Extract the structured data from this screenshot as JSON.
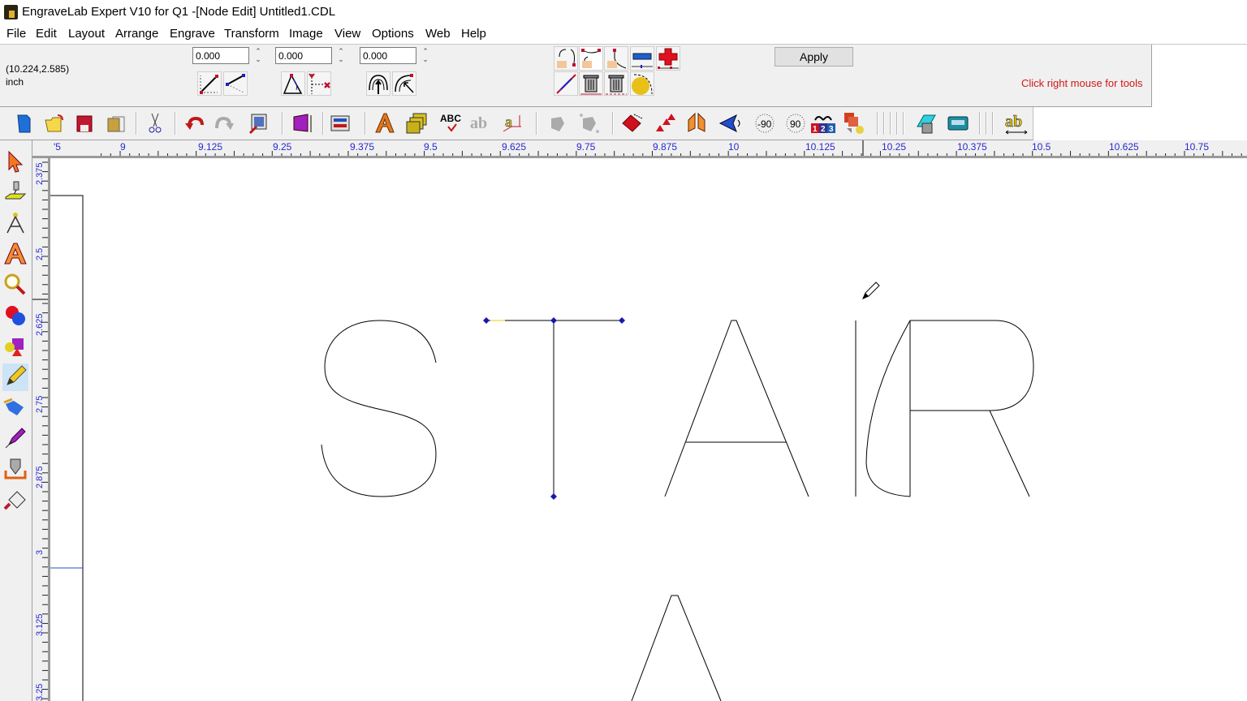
{
  "window": {
    "title": "EngraveLab Expert V10 for Q1 -[Node Edit] Untitled1.CDL",
    "app_icon": "engravelab-app-icon"
  },
  "menu": [
    "File",
    "Edit",
    "Layout",
    "Arrange",
    "Engrave",
    "Transform",
    "Image",
    "View",
    "Options",
    "Web",
    "Help"
  ],
  "property_bar": {
    "cursor_position": "(10.224,2.585)",
    "units": "inch",
    "fields": [
      {
        "value": "0.000",
        "icons": [
          "line-length-icon",
          "line-direction-icon"
        ]
      },
      {
        "value": "0.000",
        "icons": [
          "angle-icon",
          "delete-x-axis-icon"
        ]
      },
      {
        "value": "0.000",
        "icons": [
          "arc-up-icon",
          "arc-pointer-icon"
        ]
      }
    ],
    "node_tools": [
      "break-node-icon",
      "join-nodes-icon",
      "extend-node-icon",
      "delete-node-icon",
      "add-node-icon",
      "to-line-icon",
      "trash-node-icon",
      "trash-segment-icon",
      "to-curve-icon"
    ],
    "apply_label": "Apply",
    "hint": "Click right mouse for tools",
    "hint_color": "#d01818"
  },
  "toolbar": {
    "buttons": [
      "new-file-icon",
      "open-file-icon",
      "save-icon",
      "save-as-icon",
      "cut-icon",
      "undo-icon",
      "redo-icon",
      "import-icon",
      "page-size-icon",
      "layout-icon",
      "text-icon",
      "text-frames-icon",
      "spell-check-icon",
      "text-shadow-icon",
      "text-kerning-icon",
      "group-icon",
      "ungroup-icon",
      "weld-icon",
      "distribute-icon",
      "mirror-icon",
      "flip-icon",
      "rotate-minus-90-icon",
      "rotate-90-icon",
      "sequence-icon",
      "order-icon",
      "engrave-preview-icon",
      "control-panel-icon",
      "text-width-icon"
    ],
    "rotate_minus_label": "-90",
    "rotate_plus_label": "90",
    "spell_label": "ABC",
    "ab_label": "ab",
    "seq_labels": [
      "1",
      "2",
      "3"
    ]
  },
  "rulers": {
    "horizontal": [
      "'5",
      "9",
      "9.125",
      "9.25",
      "9.375",
      "9.5",
      "9.625",
      "9.75",
      "9.875",
      "10",
      "10.125",
      "10.25",
      "10.375",
      "10.5",
      "10.625",
      "10.75"
    ],
    "vertical": [
      "2.375",
      "2.5",
      "2.625",
      "2.75",
      "2.875",
      "3",
      "3.125",
      "3.25"
    ],
    "accent_color": "#2828d0"
  },
  "left_tools": [
    "select-tool-icon",
    "engrave-tool-icon",
    "node-tool-icon",
    "text-tool-icon",
    "zoom-tool-icon",
    "color-tool-icon",
    "shape-tool-icon",
    "pencil-tool-icon",
    "fill-tool-icon",
    "pen-tool-icon",
    "cutter-tool-icon",
    "eraser-tool-icon"
  ],
  "active_left_tool": "pencil-tool-icon",
  "canvas": {
    "text_shapes": [
      "S",
      "T",
      "A",
      "I",
      "R",
      "A"
    ],
    "node_color": "#1818b0"
  }
}
